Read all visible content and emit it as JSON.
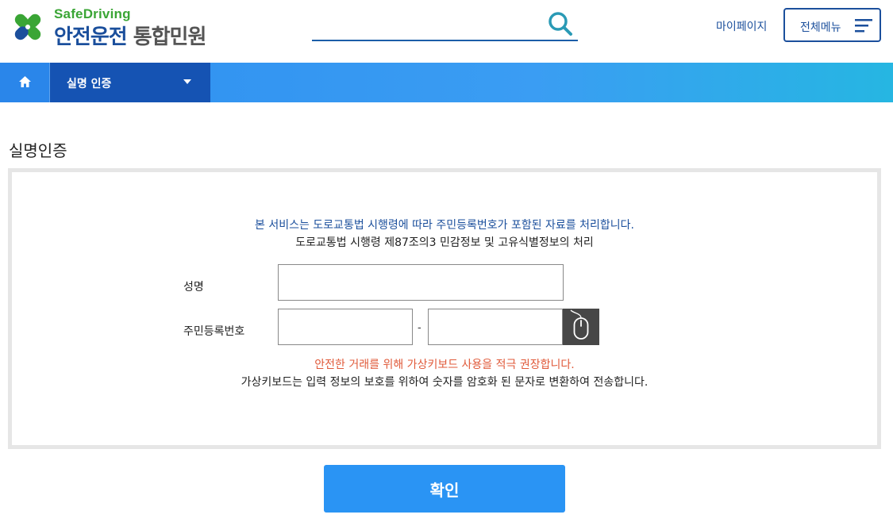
{
  "header": {
    "logo_en": "SafeDriving",
    "logo_ko_main": "안전운전",
    "logo_ko_sub": "통합민원",
    "search_placeholder": "",
    "search_icon": "search-icon",
    "mypage_label": "마이페이지",
    "allmenu_label": "전체메뉴",
    "allmenu_icon": "hamburger-icon"
  },
  "nav": {
    "home_icon": "home-icon",
    "dropdown_label": "실명 인증",
    "dropdown_icon": "caret-down-icon"
  },
  "page": {
    "title": "실명인증",
    "notice_line1": "본 서비스는 도로교통법 시행령에 따라 주민등록번호가 포함된 자료를 처리합니다.",
    "notice_line2": "도로교통법 시행령 제87조의3 민감정보 및 고유식별정보의 처리",
    "form": {
      "name_label": "성명",
      "name_value": "",
      "rrn_label": "주민등록번호",
      "rrn_front_value": "",
      "rrn_separator": "-",
      "rrn_back_value": "",
      "virtual_keyboard_icon": "mouse-icon"
    },
    "warning_line1": "안전한 거래를 위해 가상키보드 사용을 적극 권장합니다.",
    "warning_line2": "가상키보드는 입력 정보의 보호를 위하여 숫자를 암호화 된 문자로 변환하여 전송합니다.",
    "confirm_label": "확인"
  },
  "colors": {
    "brand_blue": "#1b4f9c",
    "brand_green": "#3aa535",
    "nav_gradient_start": "#2e8ff0",
    "nav_gradient_end": "#26b6e2",
    "nav_active": "#1553b3",
    "warning_red": "#e05a3a",
    "confirm_button": "#2a94f4"
  }
}
